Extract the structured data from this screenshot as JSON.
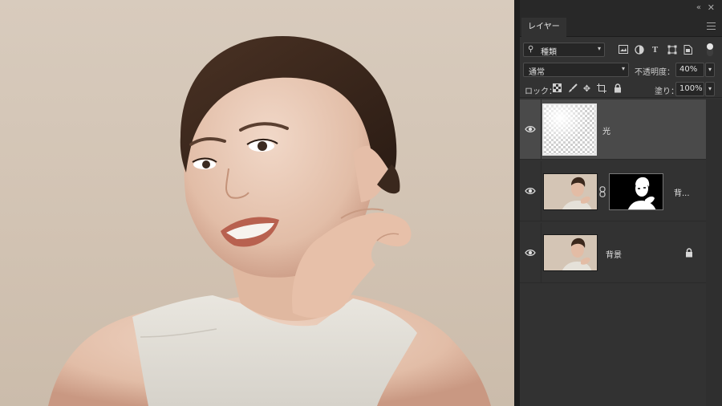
{
  "panel": {
    "tab_label": "レイヤー",
    "collapse_icon": "double-chevron-left-icon",
    "close_icon": "close-icon",
    "menu_icon": "hamburger-menu-icon"
  },
  "filter": {
    "kind_label": "種類",
    "icons": [
      "image-filter-icon",
      "adjustment-filter-icon",
      "type-filter-icon",
      "shape-filter-icon",
      "smart-object-filter-icon"
    ]
  },
  "blend": {
    "mode": "通常",
    "opacity_label": "不透明度：",
    "opacity_value": "40%"
  },
  "lock": {
    "label": "ロック：",
    "fill_label": "塗り：",
    "fill_value": "100%"
  },
  "layers": [
    {
      "name": "光",
      "visible": true,
      "selected": true,
      "thumb": "transparent",
      "has_mask": false,
      "locked": false
    },
    {
      "name": "背...",
      "visible": true,
      "selected": false,
      "thumb": "photo",
      "has_mask": true,
      "locked": false
    },
    {
      "name": "背景",
      "visible": true,
      "selected": false,
      "thumb": "photo",
      "has_mask": false,
      "locked": true
    }
  ],
  "colors": {
    "panel_bg": "#323232",
    "selected_layer": "#4a4a4a",
    "canvas_backdrop": "#d5c7b8"
  }
}
